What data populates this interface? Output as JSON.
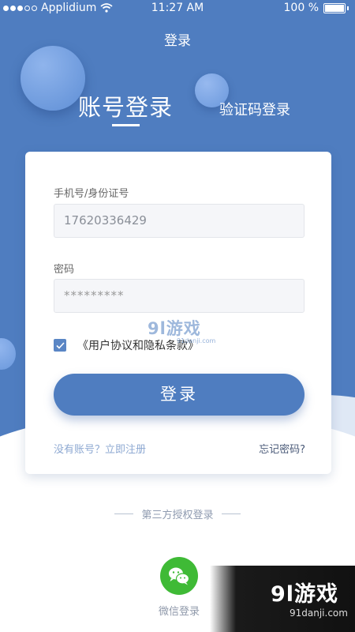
{
  "status_bar": {
    "carrier": "Applidium",
    "time": "11:27 AM",
    "battery": "100 %"
  },
  "nav": {
    "title": "登录"
  },
  "tabs": [
    {
      "label": "账号登录",
      "active": true
    },
    {
      "label": "验证码登录",
      "active": false
    }
  ],
  "form": {
    "phone_label": "手机号/身份证号",
    "phone_value": "17620336429",
    "password_label": "密码",
    "password_value": "*********",
    "agreement_checked": true,
    "agreement_text": "《用户协议和隐私条款》",
    "login_button": "登录",
    "register_link": "没有账号？立即注册",
    "forgot_link": "忘记密码?"
  },
  "third_party": {
    "title": "第三方授权登录",
    "wechat_label": "微信登录"
  },
  "watermarks": {
    "center": "9l游戏",
    "center_sub": "91danji.com",
    "corner_main": "9l游戏",
    "corner_sub": "91danji.com"
  },
  "colors": {
    "primary": "#4f7dc0",
    "wechat": "#3fba36"
  },
  "icons": [
    "signal-dots-icon",
    "wifi-icon",
    "battery-icon",
    "checkbox-checked-icon",
    "wechat-icon"
  ]
}
